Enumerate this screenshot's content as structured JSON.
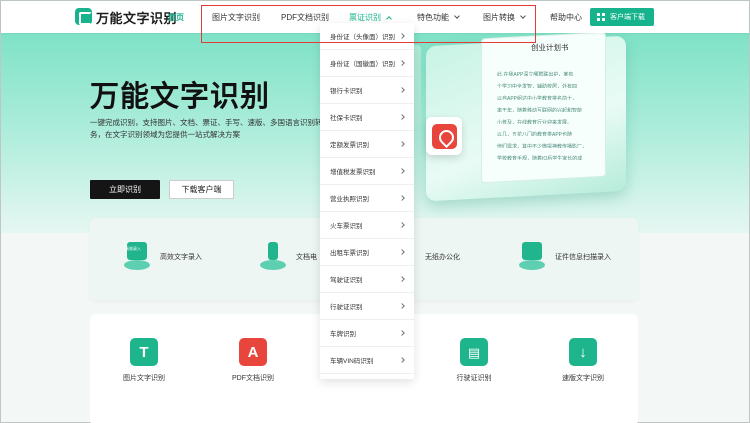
{
  "header": {
    "brand": "万能文字识别",
    "home": "首页",
    "nav": [
      {
        "label": "图片文字识别",
        "has_dropdown": false
      },
      {
        "label": "PDF文档识别",
        "has_dropdown": false
      },
      {
        "label": "票证识别",
        "has_dropdown": true,
        "active": true
      },
      {
        "label": "特色功能",
        "has_dropdown": true
      },
      {
        "label": "图片转换",
        "has_dropdown": true
      }
    ],
    "help": "帮助中心",
    "download": "客户端下载"
  },
  "hero": {
    "title": "万能文字识别",
    "desc": "一键完成识别，支持图片、文档、票证、手写、速版、多国语言识别转换服务，在文字识别领域为您提供一站式解决方案",
    "primary_btn": "立即识别",
    "secondary_btn": "下载客户端",
    "plan_title": "创业计划书",
    "plan_lines": [
      "此,在我APP深立哪群联出护，某有",
      "个学习中全发智，辅助校居，外有四",
      "以自APP组达中小学教育排名前十，",
      "率于年，随着移动互联网的兴起和智能",
      "小普及，在线教育行业迎来发展。",
      "以几，五花八门的教育类APP也随",
      "他们需求，其中不少微提神教传播影厂，",
      "学校教育手规，随着IO后学生家长的成"
    ]
  },
  "dropdown": {
    "items": [
      "身份证（头像面）识别",
      "身份证（国徽面）识别",
      "银行卡识别",
      "社保卡识别",
      "定额发票识别",
      "增值税发票识别",
      "营业执照识别",
      "火车票识别",
      "出租车票识别",
      "驾驶证识别",
      "行驶证识别",
      "车牌识别",
      "车辆VIN码识别"
    ]
  },
  "features": [
    {
      "label": "高效文字录入",
      "badge": "高效录入"
    },
    {
      "label": "文档电"
    },
    {
      "label": "无纸办公化"
    },
    {
      "label": "证件信息扫描录入"
    }
  ],
  "tools": [
    {
      "label": "图片文字识别",
      "color": "#1eb48c",
      "glyph": "T"
    },
    {
      "label": "PDF文档识别",
      "color": "#e8453c",
      "glyph": "A"
    },
    {
      "label": "行驶证识别",
      "color": "#1eb48c",
      "glyph": "▤"
    },
    {
      "label": "速版文字识别",
      "color": "#1eb48c",
      "glyph": "↓"
    }
  ],
  "colors": {
    "accent": "#16b38c",
    "highlight": "#e23b3b"
  }
}
